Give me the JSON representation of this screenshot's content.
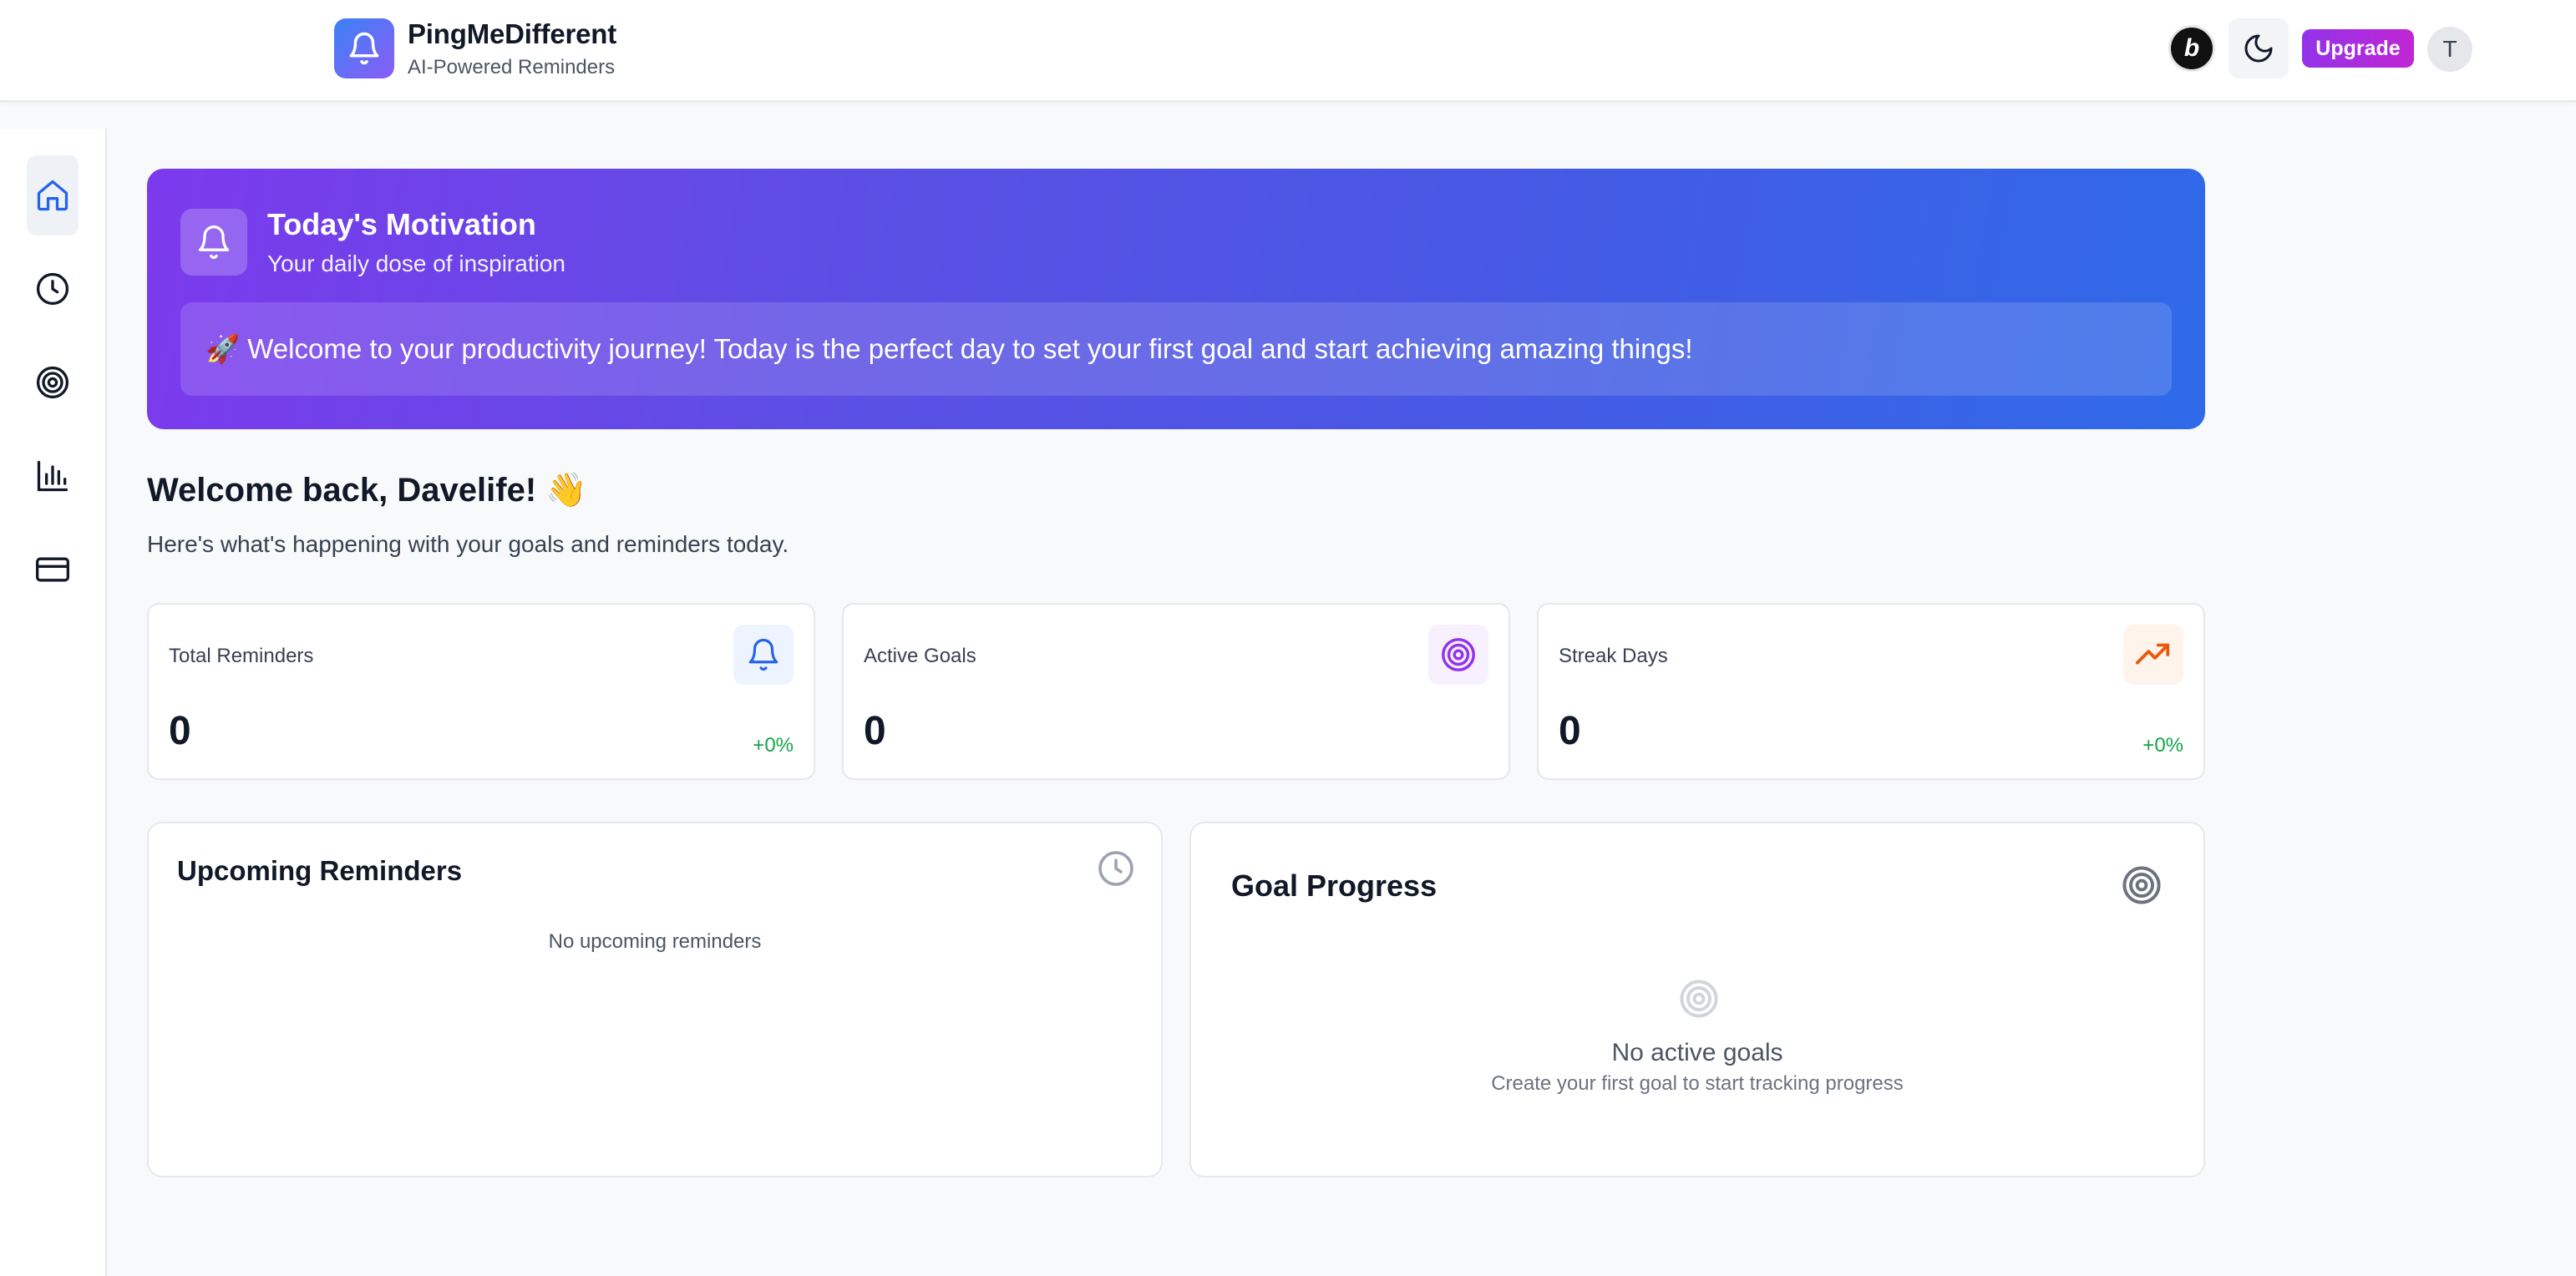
{
  "header": {
    "app_name": "PingMeDifferent",
    "tagline": "AI-Powered Reminders",
    "extension_label": "b",
    "upgrade_label": "Upgrade",
    "avatar_initial": "T"
  },
  "sidebar": {
    "items": [
      {
        "name": "home",
        "icon": "home-icon",
        "active": true
      },
      {
        "name": "reminders",
        "icon": "clock-icon",
        "active": false
      },
      {
        "name": "goals",
        "icon": "target-icon",
        "active": false
      },
      {
        "name": "analytics",
        "icon": "bar-chart-icon",
        "active": false
      },
      {
        "name": "billing",
        "icon": "credit-card-icon",
        "active": false
      }
    ]
  },
  "motivation": {
    "title": "Today's Motivation",
    "subtitle": "Your daily dose of inspiration",
    "message": "🚀 Welcome to your productivity journey! Today is the perfect day to set your first goal and start achieving amazing things!"
  },
  "welcome": {
    "title": "Welcome back, Davelife! 👋",
    "subtitle": "Here's what's happening with your goals and reminders today."
  },
  "stats": [
    {
      "label": "Total Reminders",
      "value": "0",
      "change": "+0%",
      "icon": "bell-icon",
      "accent": "#2563eb"
    },
    {
      "label": "Active Goals",
      "value": "0",
      "change": "",
      "icon": "target-icon",
      "accent": "#9333ea"
    },
    {
      "label": "Streak Days",
      "value": "0",
      "change": "+0%",
      "icon": "trending-up-icon",
      "accent": "#ea580c"
    }
  ],
  "upcoming": {
    "title": "Upcoming Reminders",
    "empty_text": "No upcoming reminders"
  },
  "goal_progress": {
    "title": "Goal Progress",
    "empty_title": "No active goals",
    "empty_sub": "Create your first goal to start tracking progress"
  },
  "colors": {
    "primary": "#2563eb",
    "purple": "#9333ea",
    "orange": "#ea580c",
    "success": "#16a34a"
  }
}
